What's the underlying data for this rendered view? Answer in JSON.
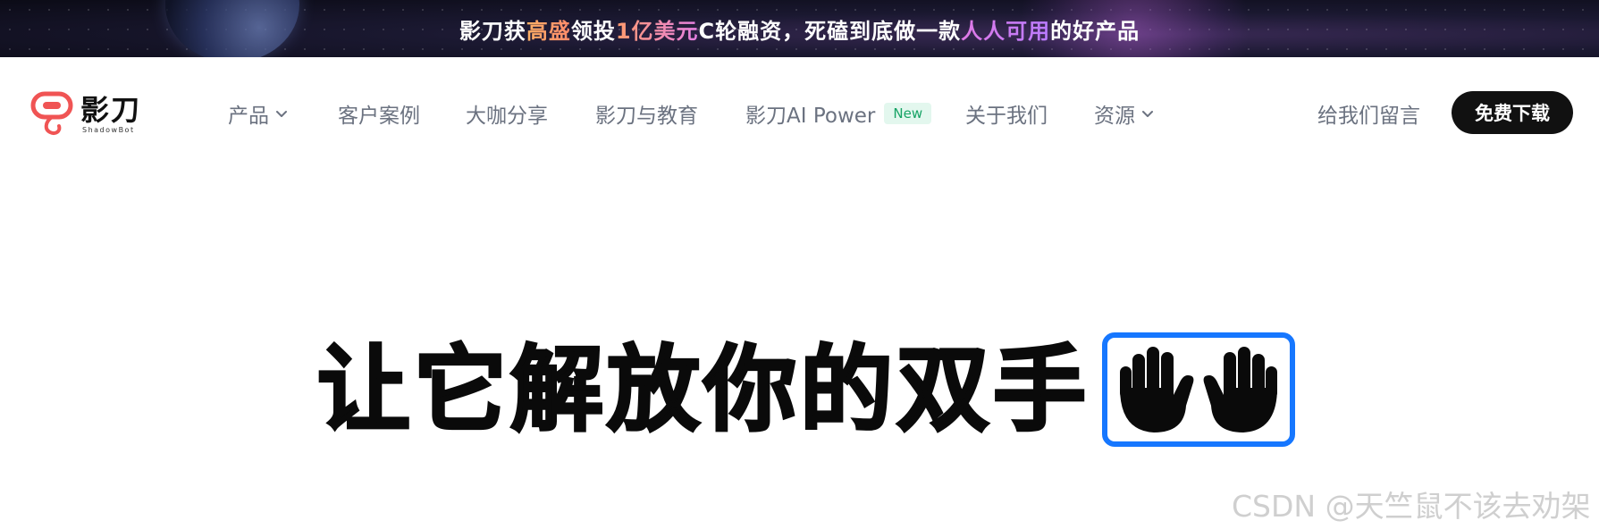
{
  "banner": {
    "part1": "影刀获",
    "part2": "高盛",
    "part3": "领投",
    "part4": "1亿美元",
    "part5": "C轮融资，死磕到底做一款",
    "part6": "人人可用",
    "part7": "的好产品"
  },
  "brand": {
    "name": "影刀",
    "subtitle": "ShadowBot",
    "logo_color": "#f05454"
  },
  "nav": {
    "items": [
      {
        "label": "产品",
        "dropdown": true
      },
      {
        "label": "客户案例",
        "dropdown": false
      },
      {
        "label": "大咖分享",
        "dropdown": false
      },
      {
        "label": "影刀与教育",
        "dropdown": false
      },
      {
        "label": "影刀AI Power",
        "badge": "New",
        "dropdown": false
      },
      {
        "label": "关于我们",
        "dropdown": false
      },
      {
        "label": "资源",
        "dropdown": true
      }
    ],
    "message_link": "给我们留言",
    "download_button": "免费下载"
  },
  "hero": {
    "title": "让它解放你的双手",
    "icon": "raised-hands-icon",
    "accent_color": "#1677ff"
  },
  "watermark": "CSDN @天竺鼠不该去劝架"
}
